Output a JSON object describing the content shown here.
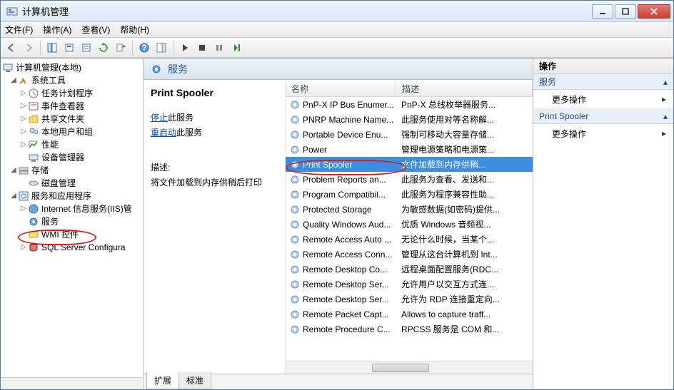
{
  "window": {
    "title": "计算机管理"
  },
  "menu": {
    "file": "文件(F)",
    "action": "操作(A)",
    "view": "查看(V)",
    "help": "帮助(H)"
  },
  "tree": {
    "root": "计算机管理(本地)",
    "tools": "系统工具",
    "tools_children": {
      "scheduler": "任务计划程序",
      "eventviewer": "事件查看器",
      "shared": "共享文件夹",
      "users": "本地用户和组",
      "perf": "性能",
      "devicemgr": "设备管理器"
    },
    "storage": "存储",
    "storage_children": {
      "diskmgr": "磁盘管理"
    },
    "svcapp": "服务和应用程序",
    "svcapp_children": {
      "iis": "Internet 信息服务(IIS)管",
      "services": "服务",
      "wmi": "WMI 控件",
      "sql": "SQL Server Configura"
    }
  },
  "center": {
    "heading": "服务",
    "selected_name": "Print Spooler",
    "stop_link": "停止",
    "stop_suffix": "此服务",
    "restart_link": "重启动",
    "restart_suffix": "此服务",
    "desc_label": "描述:",
    "desc_text": "将文件加载到内存供稍后打印"
  },
  "columns": {
    "name": "名称",
    "desc": "描述"
  },
  "services": [
    {
      "name": "PnP-X IP Bus Enumer...",
      "desc": "PnP-X 总线枚举器服务..."
    },
    {
      "name": "PNRP Machine Name...",
      "desc": "此服务使用对等名称解..."
    },
    {
      "name": "Portable Device Enu...",
      "desc": "强制可移动大容量存储..."
    },
    {
      "name": "Power",
      "desc": "管理电源策略和电源策..."
    },
    {
      "name": "Print Spooler",
      "desc": "文件加载到内存供稍..."
    },
    {
      "name": "Problem Reports an...",
      "desc": "此服务为查看、发送和..."
    },
    {
      "name": "Program Compatibil...",
      "desc": "此服务为程序兼容性助..."
    },
    {
      "name": "Protected Storage",
      "desc": "为敏感数据(如密码)提供..."
    },
    {
      "name": "Quality Windows Aud...",
      "desc": "优质 Windows 音频视..."
    },
    {
      "name": "Remote Access Auto ...",
      "desc": "无论什么时候，当某个..."
    },
    {
      "name": "Remote Access Conn...",
      "desc": "管理从这台计算机到 Int..."
    },
    {
      "name": "Remote Desktop Co...",
      "desc": "远程桌面配置服务(RDC..."
    },
    {
      "name": "Remote Desktop Ser...",
      "desc": "允许用户以交互方式连..."
    },
    {
      "name": "Remote Desktop Ser...",
      "desc": "允许为 RDP 连接重定向..."
    },
    {
      "name": "Remote Packet Capt...",
      "desc": "Allows to capture traff..."
    },
    {
      "name": "Remote Procedure C...",
      "desc": "RPCSS 服务是 COM 和..."
    }
  ],
  "selected_index": 4,
  "tabs": {
    "ext": "扩展",
    "std": "标准"
  },
  "right": {
    "heading": "操作",
    "group1": "服务",
    "more": "更多操作",
    "group2": "Print Spooler"
  }
}
